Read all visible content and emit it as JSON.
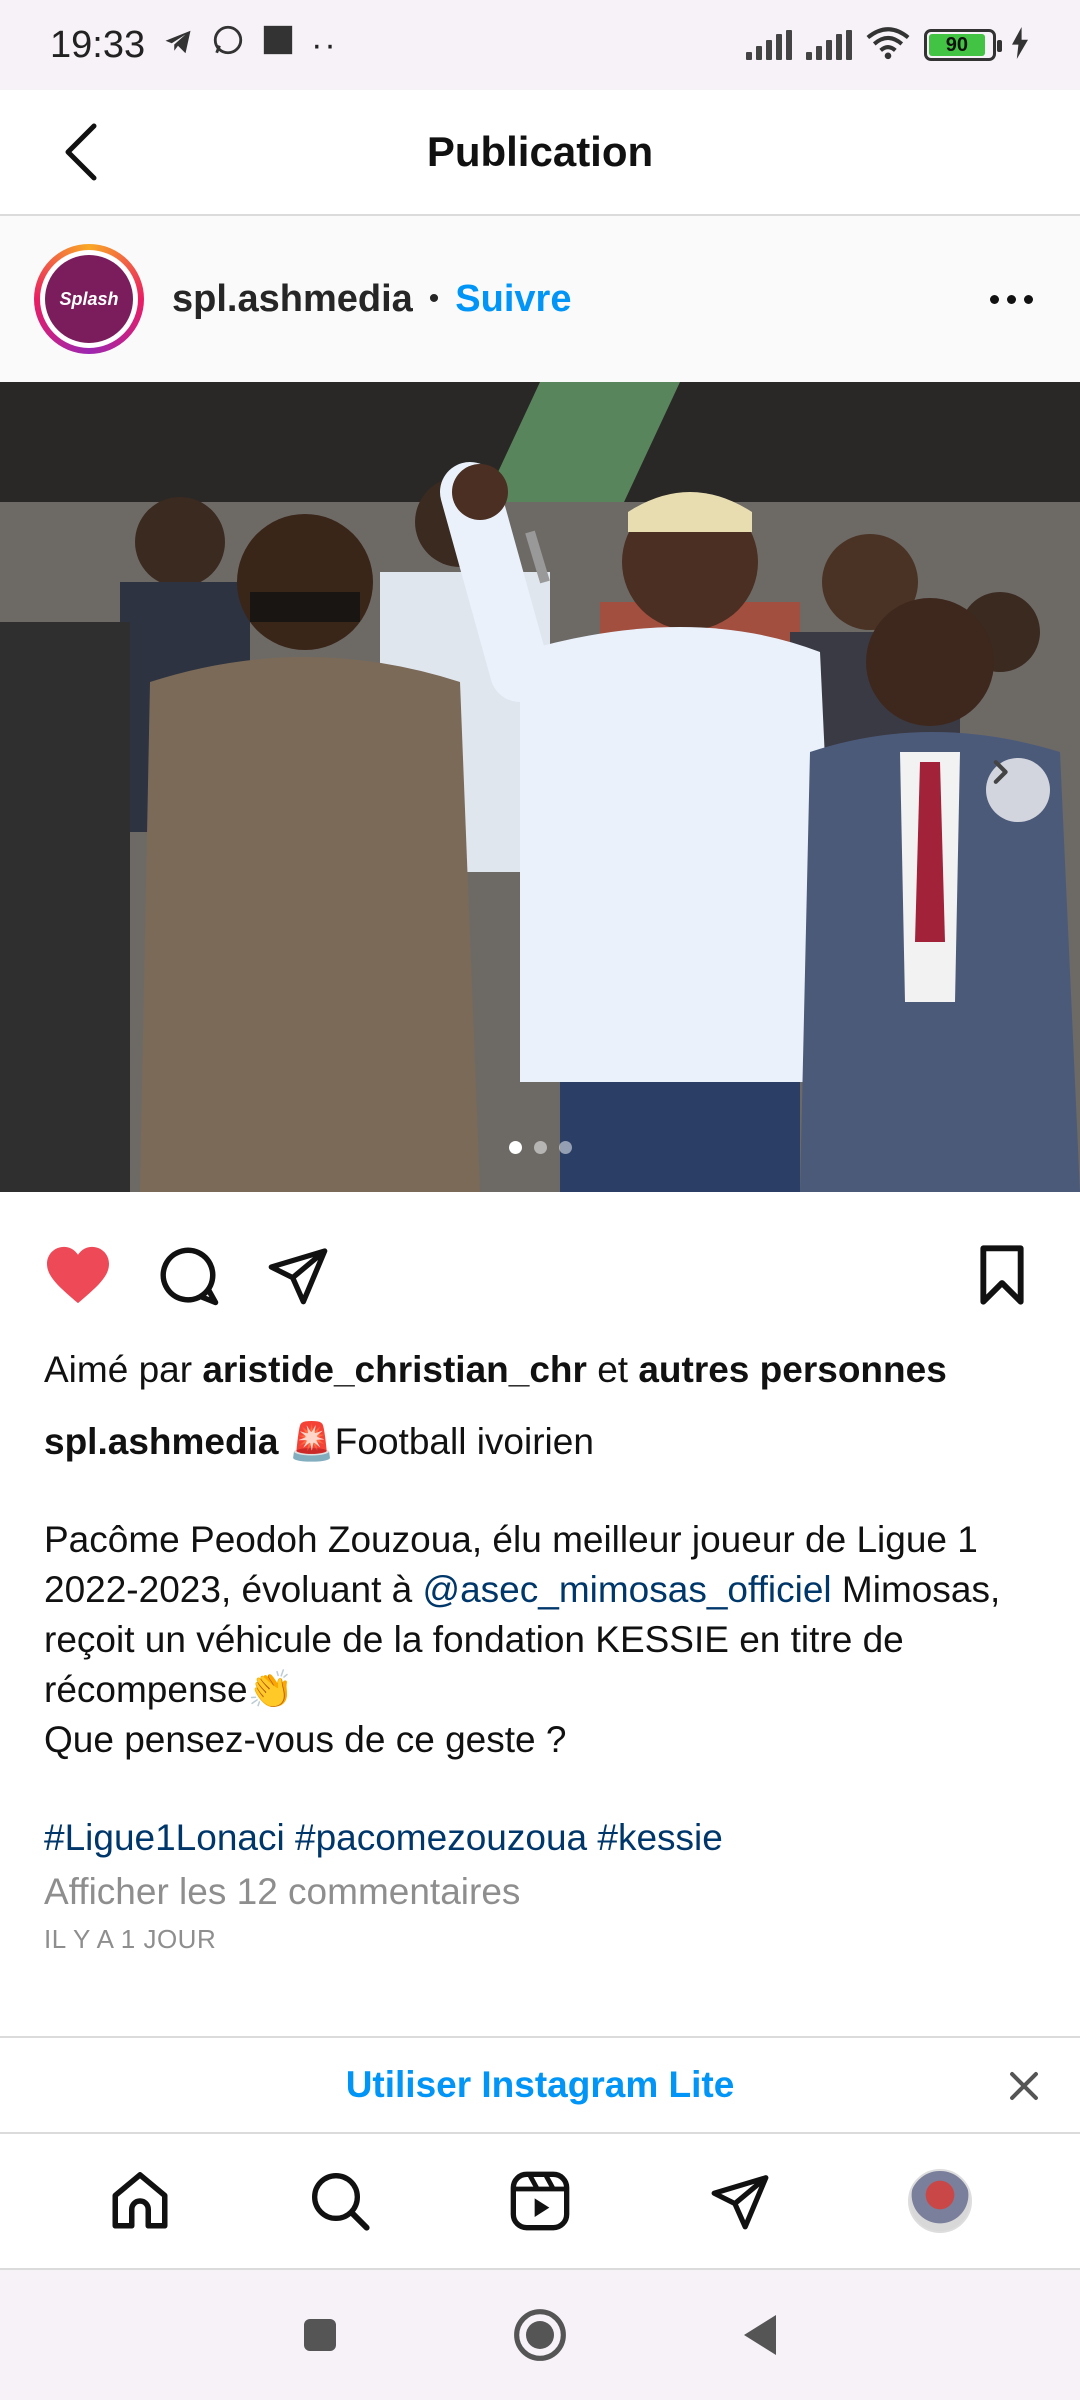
{
  "status_bar": {
    "time": "19:33",
    "battery": "90"
  },
  "header": {
    "title": "Publication"
  },
  "post": {
    "author": "spl.ashmedia",
    "avatar_text": "Splash",
    "separator": "•",
    "follow_label": "Suivre",
    "image_count": 3,
    "active_image_index": 0
  },
  "likes": {
    "prefix": "Aimé par",
    "user": "aristide_christian_chr",
    "middle": "et",
    "suffix": "autres personnes"
  },
  "caption": {
    "author": "spl.ashmedia",
    "headline": "🚨Football ivoirien",
    "body_part1": "Pacôme Peodoh Zouzoua, élu meilleur joueur de Ligue 1 2022-2023, évoluant à ",
    "mention": "@asec_mimosas_officiel",
    "body_part2": " Mimosas, reçoit un véhicule de la fondation KESSIE en titre de récompense👏",
    "body_question": "Que pensez-vous de ce geste ?",
    "hashtags": [
      "#Ligue1Lonaci",
      "#pacomezouzoua",
      "#kessie"
    ],
    "view_comments": "Afficher les 12 commentaires",
    "timestamp": "IL Y A 1 JOUR"
  },
  "banner": {
    "label": "Utiliser Instagram Lite"
  },
  "colors": {
    "accent_blue": "#0095f6",
    "like_red": "#ed4956",
    "link_dark_blue": "#00376b"
  }
}
